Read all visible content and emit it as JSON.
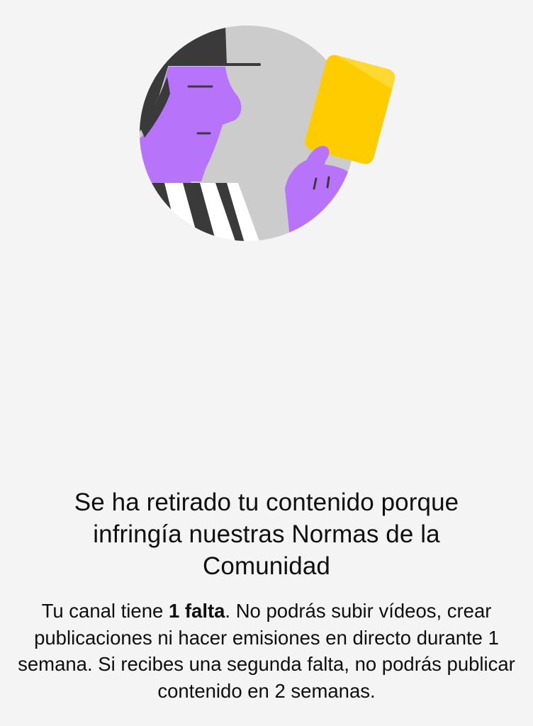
{
  "illustration": {
    "icon": "referee-yellow-card-illustration",
    "colors": {
      "circle": "#cccccc",
      "skin": "#b774fb",
      "hair": "#3a3a3a",
      "card": "#ffcc00",
      "card_highlight": "#ffd932",
      "stripe_dark": "#3a3a3a",
      "stripe_light": "#ffffff"
    }
  },
  "notice": {
    "title": "Se ha retirado tu contenido porque infringía nuestras Normas de la Comunidad",
    "body_prefix": "Tu canal tiene ",
    "body_strikes": "1 falta",
    "body_suffix": ". No podrás subir vídeos, crear publicaciones ni hacer emisiones en directo durante 1 semana. Si recibes una segunda falta, no podrás publicar contenido en 2 semanas."
  }
}
